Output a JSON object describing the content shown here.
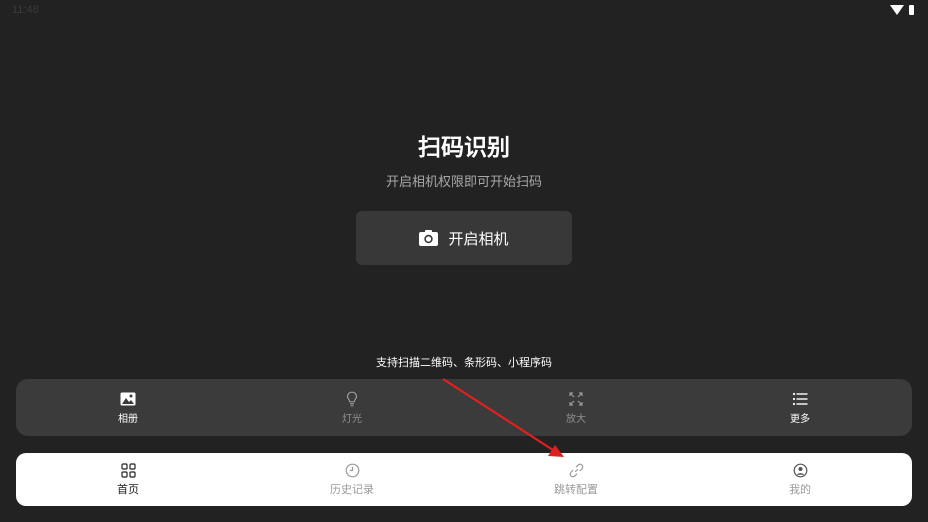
{
  "status_bar": {
    "time": "11:48",
    "icons": [
      "wifi-icon",
      "battery-icon"
    ]
  },
  "main": {
    "title": "扫码识别",
    "subtitle": "开启相机权限即可开始扫码",
    "camera_button": {
      "label": "开启相机",
      "icon": "camera-icon"
    },
    "support_text": "支持扫描二维码、条形码、小程序码"
  },
  "tool_bar": {
    "items": [
      {
        "label": "相册",
        "icon": "image-icon",
        "active": true
      },
      {
        "label": "灯光",
        "icon": "lightbulb-icon",
        "active": false
      },
      {
        "label": "放大",
        "icon": "expand-icon",
        "active": false
      },
      {
        "label": "更多",
        "icon": "list-icon",
        "active": true
      }
    ]
  },
  "bottom_nav": {
    "items": [
      {
        "label": "首页",
        "icon": "grid-icon",
        "active": true
      },
      {
        "label": "历史记录",
        "icon": "clock-icon",
        "active": false
      },
      {
        "label": "跳转配置",
        "icon": "link-icon",
        "active": false
      },
      {
        "label": "我的",
        "icon": "user-icon",
        "active": false
      }
    ]
  },
  "colors": {
    "background": "#222222",
    "button_bg": "#383838",
    "toolbar_bg": "#3b3b3b",
    "nav_bg": "#ffffff",
    "annotation_arrow": "#e0201f"
  }
}
